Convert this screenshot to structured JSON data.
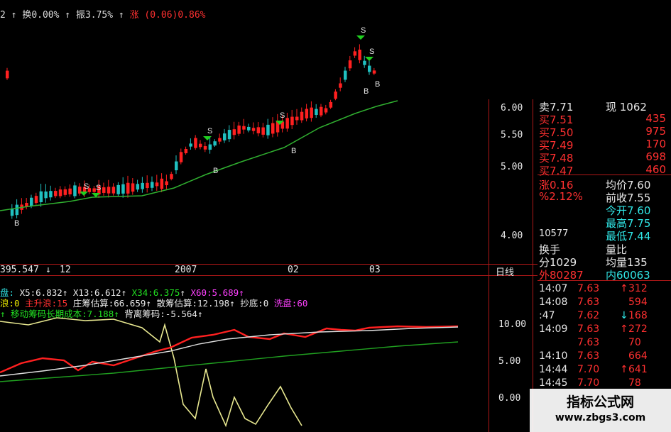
{
  "header": {
    "prefix": "2",
    "turnover": "换0.00%",
    "amplitude": "振3.75%",
    "change": "涨 (0.06)0.86%"
  },
  "price_axis": [
    "6.00",
    "5.50",
    "5.00",
    "4.00"
  ],
  "indicator_axis": [
    "10.00",
    "5.00",
    "0.00"
  ],
  "time_axis": {
    "value": "395.547",
    "labels": [
      "12",
      "2007",
      "02",
      "03"
    ],
    "period": "日线"
  },
  "indicator_line1": [
    {
      "text": "盘:",
      "color": "cyan"
    },
    {
      "text": "X5:6.832",
      "color": "white"
    },
    {
      "text": "X13:6.612",
      "color": "white"
    },
    {
      "text": "X34:6.375",
      "color": "green"
    },
    {
      "text": "X60:5.689",
      "color": "magenta"
    }
  ],
  "indicator_line2": [
    {
      "text": "浪:0",
      "color": "yellow"
    },
    {
      "text": "主升浪:15",
      "color": "red"
    },
    {
      "text": "庄筹估算:66.659",
      "color": "white"
    },
    {
      "text": "散筹估算:12.198",
      "color": "white"
    },
    {
      "text": "抄底:0",
      "color": "white"
    },
    {
      "text": "洗盘:60",
      "color": "magenta"
    }
  ],
  "indicator_line3": [
    {
      "text": "移动筹码长期成本:7.188",
      "color": "green"
    },
    {
      "text": "背离筹码:-5.564",
      "color": "white"
    }
  ],
  "quote": {
    "top_partial": {
      "left": "卖7.71",
      "right": "现 1062"
    },
    "bids": [
      {
        "label": "买7.51",
        "vol": "435"
      },
      {
        "label": "买7.50",
        "vol": "975"
      },
      {
        "label": "买7.49",
        "vol": "170"
      },
      {
        "label": "买7.48",
        "vol": "698"
      },
      {
        "label": "买7.47",
        "vol": "460"
      }
    ],
    "change_row": {
      "left": "涨0.16",
      "right": "均价7.60"
    },
    "pct_row": {
      "left": "%2.12%",
      "right": "前收7.55"
    },
    "today": "今开7.60",
    "high": "最高7.75",
    "low": "最低7.44",
    "vol_partial": "10577",
    "turnover_row": {
      "left": "换手",
      "right": "量比"
    },
    "minute_row": {
      "left": "分1029",
      "right": "均量135"
    },
    "outer_row": {
      "left": "外80287",
      "right": "内60063"
    }
  },
  "ticks": [
    {
      "time": "14:07",
      "price": "7.63",
      "arrow": "up",
      "vol": "312"
    },
    {
      "time": "14:08",
      "price": "7.63",
      "arrow": "none",
      "vol": "594"
    },
    {
      "time": ":47",
      "price": "7.62",
      "arrow": "down",
      "vol": "168"
    },
    {
      "time": "14:09",
      "price": "7.63",
      "arrow": "up",
      "vol": "272"
    },
    {
      "time": "",
      "price": "7.63",
      "arrow": "none",
      "vol": "70"
    },
    {
      "time": "14:10",
      "price": "7.63",
      "arrow": "none",
      "vol": "664"
    },
    {
      "time": "14:44",
      "price": "7.70",
      "arrow": "up",
      "vol": "641"
    },
    {
      "time": "14:45",
      "price": "7.70",
      "arrow": "none",
      "vol": "78"
    }
  ],
  "markers": {
    "sell": "S",
    "buy": "B"
  },
  "watermark": {
    "line1": "指标公式网",
    "line2": "www.zbgs3.com"
  },
  "colors": {
    "up": "#ff2020",
    "down": "#20c0c0",
    "ma": "#30b030",
    "yellow_line": "#e8e890",
    "white_line": "#e0e0e0",
    "green_line": "#20a020"
  }
}
